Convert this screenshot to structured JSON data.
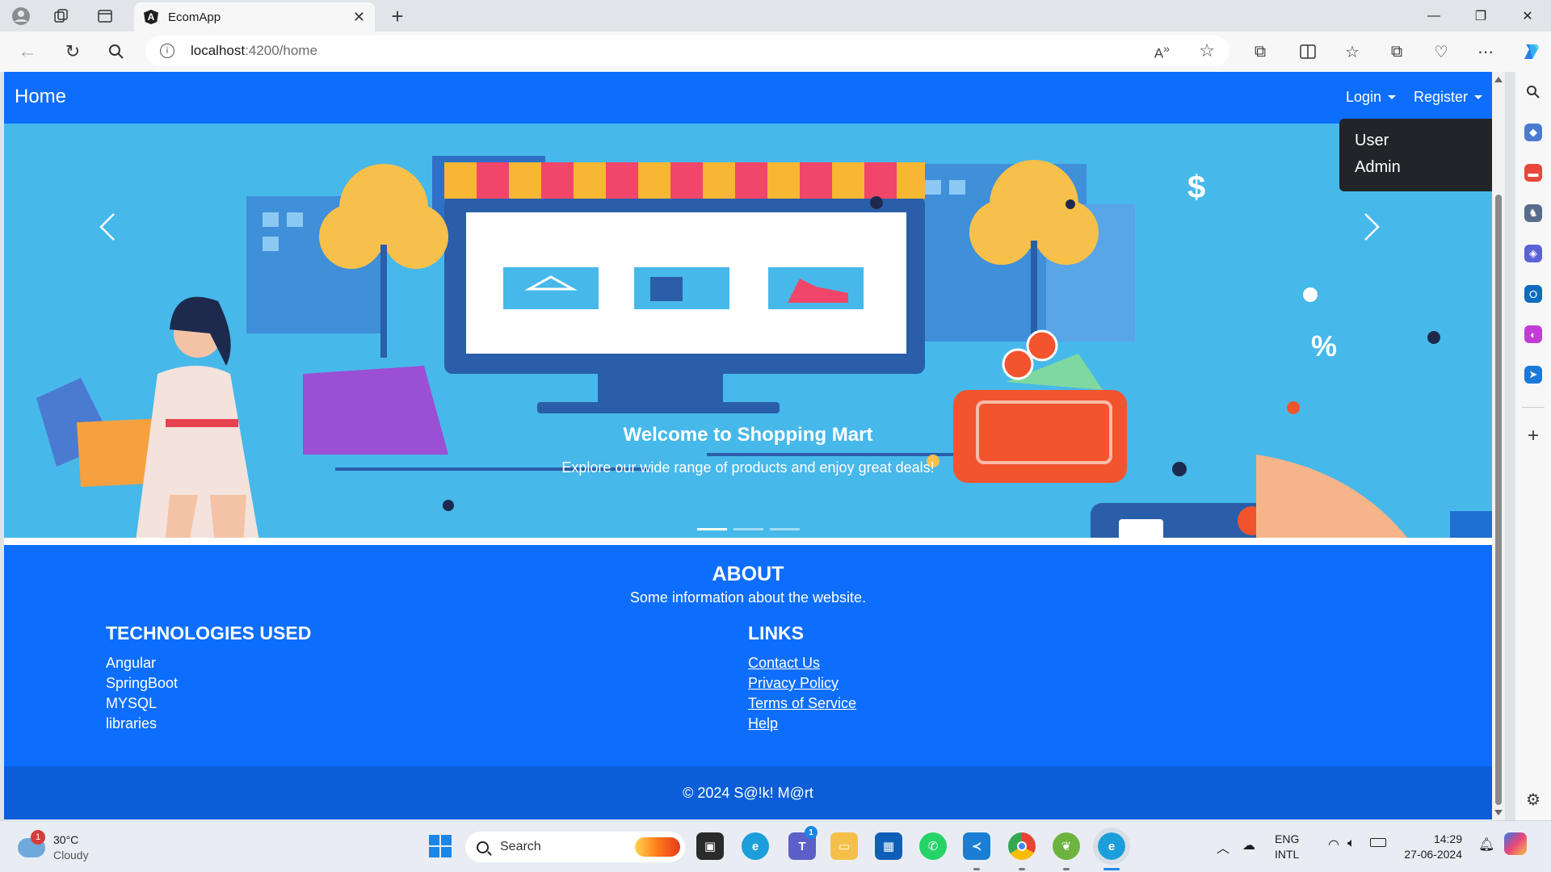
{
  "browser": {
    "tab_title": "EcomApp",
    "url_host": "localhost",
    "url_path": ":4200/home"
  },
  "page": {
    "navbar": {
      "brand": "Home",
      "login_label": "Login",
      "register_label": "Register",
      "dropdown_items": [
        "User",
        "Admin"
      ]
    },
    "carousel": {
      "caption_title": "Welcome to Shopping Mart",
      "caption_text": "Explore our wide range of products and enjoy great deals!",
      "slide_count": 3,
      "active_slide": 1
    },
    "footer": {
      "about_title": "ABOUT",
      "about_text": "Some information about the website.",
      "tech_title": "TECHNOLOGIES USED",
      "tech_items": [
        "Angular",
        "SpringBoot",
        "MYSQL",
        "libraries"
      ],
      "links_title": "LINKS",
      "links_items": [
        "Contact Us",
        "Privacy Policy",
        "Terms of Service",
        "Help"
      ],
      "copyright": "© 2024 S@!k! M@rt"
    }
  },
  "taskbar": {
    "weather_temp": "30°C",
    "weather_cond": "Cloudy",
    "weather_badge": "1",
    "search_placeholder": "Search",
    "teams_badge": "1",
    "lang_line1": "ENG",
    "lang_line2": "INTL",
    "time": "14:29",
    "date": "27-06-2024"
  },
  "colors": {
    "primary": "#0d6efd",
    "carousel_bg": "#47b8ea",
    "dropdown_bg": "#212529"
  }
}
